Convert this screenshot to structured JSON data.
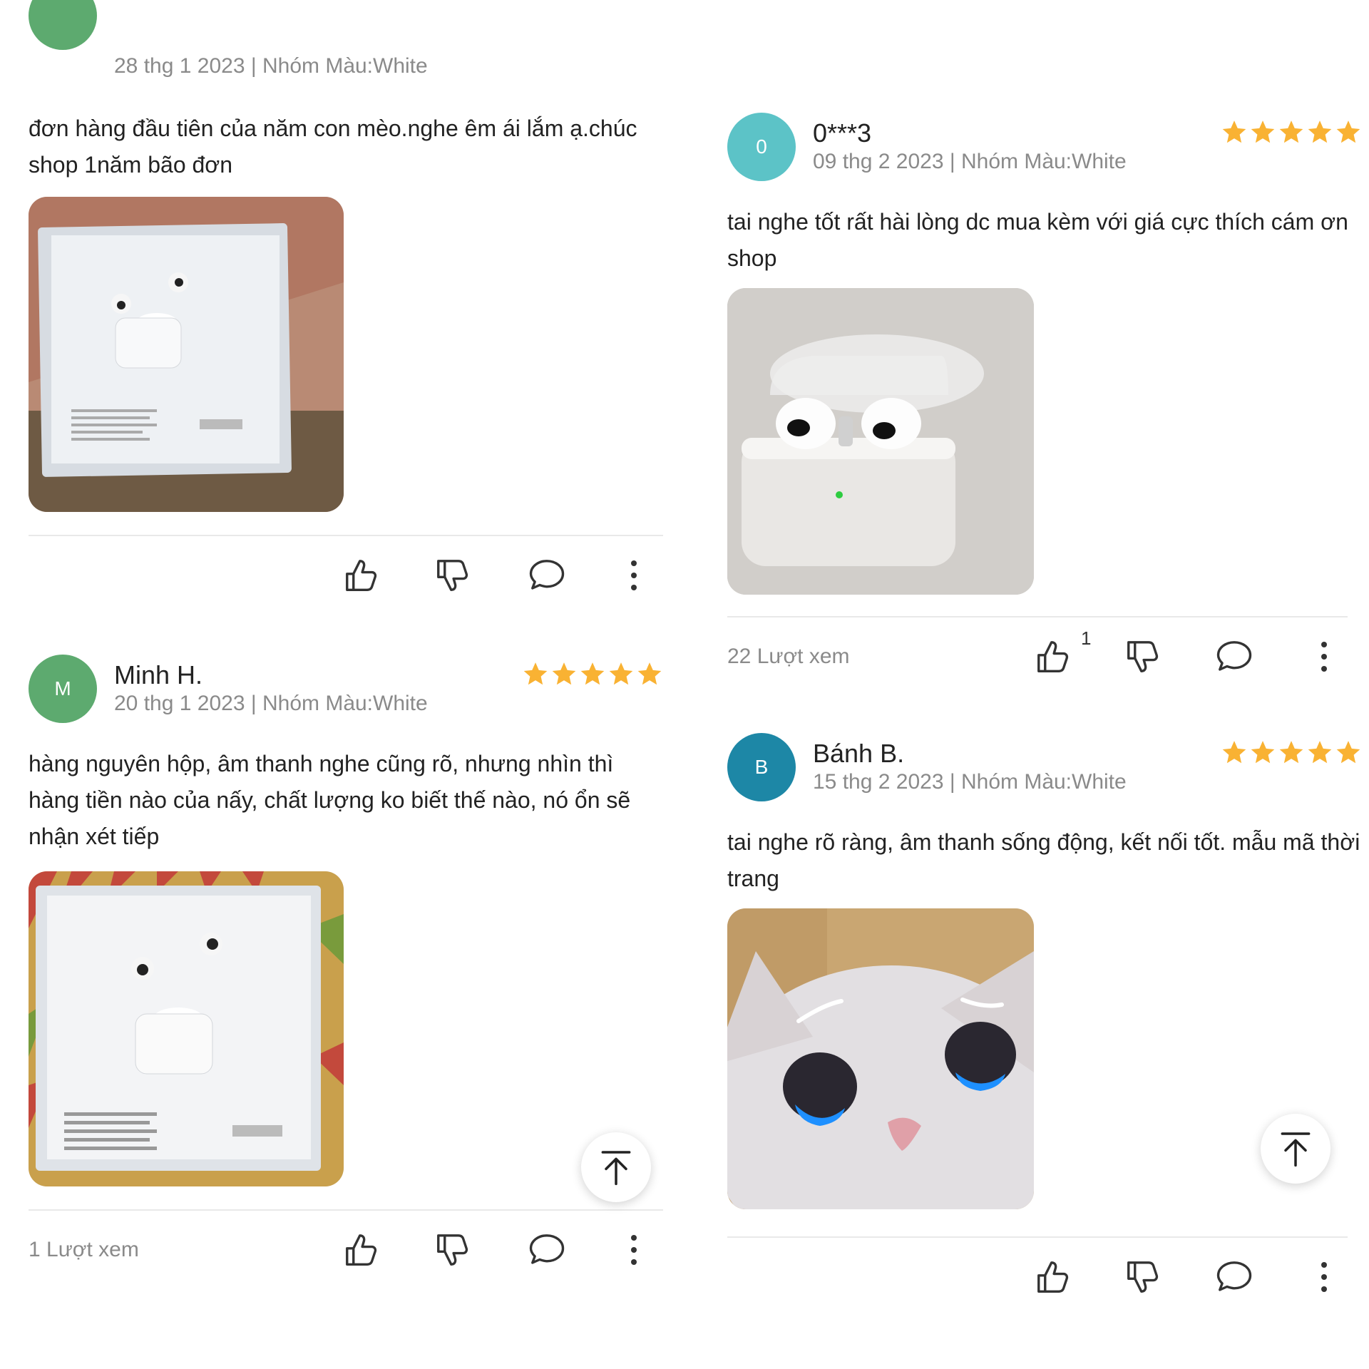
{
  "colors": {
    "star": "#f9b233",
    "avatar_green": "#5daa6f",
    "avatar_teal": "#5cc3c7",
    "avatar_blue": "#1d87a6",
    "meta_gray": "#8a8a8a"
  },
  "left": {
    "partial_review": {
      "meta": "28 thg 1 2023 | Nhóm Màu:White",
      "text": "đơn hàng đầu tiên của năm con mèo.nghe êm ái lắm ạ.chúc shop 1năm bão đơn",
      "photo_icon": "airpods-box-photo"
    },
    "review_minh": {
      "avatar_letter": "M",
      "name": "Minh H.",
      "rating": 5,
      "meta": "20 thg 1 2023 | Nhóm Màu:White",
      "text": "hàng nguyên hộp, âm thanh nghe cũng rõ, nhưng nhìn thì hàng tiền nào của nấy, chất lượng ko biết thế nào, nó ổn sẽ nhận xét tiếp",
      "photo_icon": "airpods-box-wrapped-photo",
      "views": "1 Lượt xem"
    }
  },
  "right": {
    "review_0": {
      "avatar_letter": "0",
      "name": "0***3",
      "rating": 5,
      "meta": "09 thg 2 2023 | Nhóm Màu:White",
      "text": "tai nghe tốt rất hài lòng dc mua kèm với giá cực thích cám ơn shop",
      "photo_icon": "airpods-case-photo",
      "views": "22 Lượt xem",
      "like_count": "1"
    },
    "review_banh": {
      "avatar_letter": "B",
      "name": "Bánh B.",
      "rating": 5,
      "meta": "15 thg 2 2023 | Nhóm Màu:White",
      "text": "tai nghe rõ ràng,  âm thanh sống động,  kết nối tốt.  mẫu mã thời trang",
      "photo_icon": "crying-cat-photo"
    }
  }
}
